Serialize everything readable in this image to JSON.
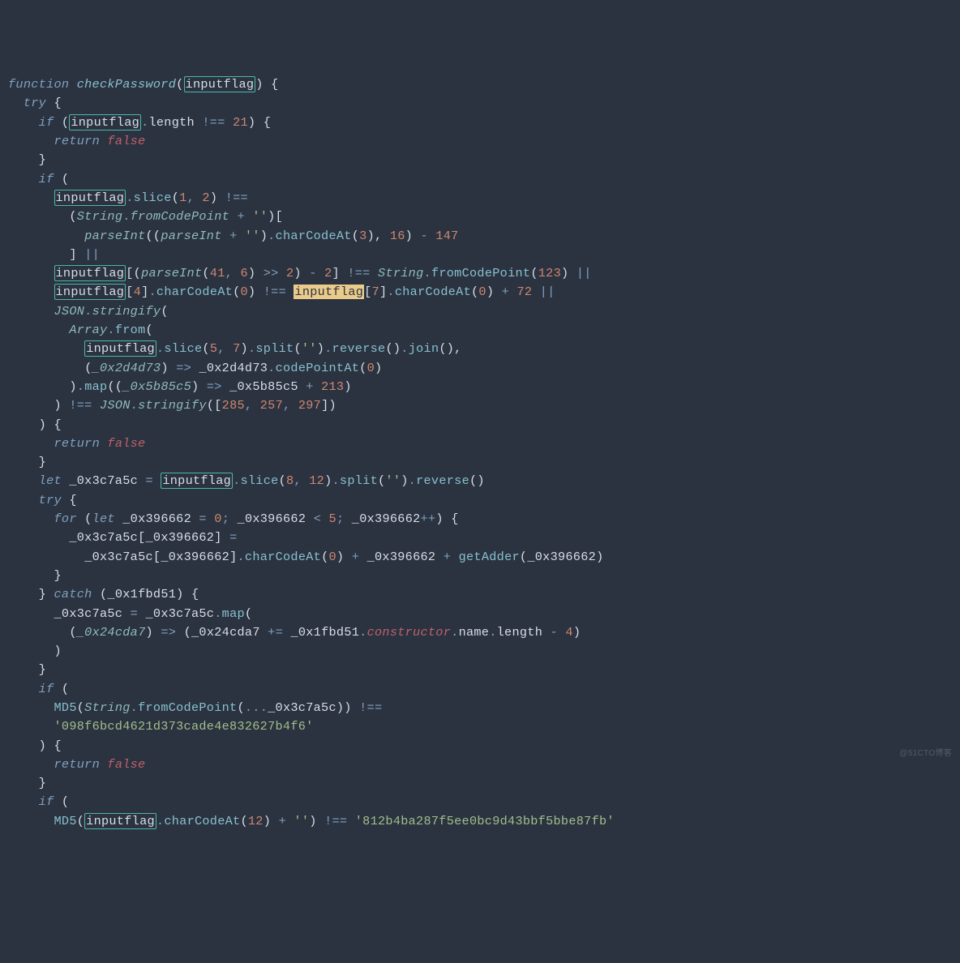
{
  "t": {
    "function": "function",
    "checkPassword": "checkPassword",
    "inputflag": "inputflag",
    "try": "try",
    "if": "if",
    "length": "length",
    "neq": "!==",
    "return": "return",
    "false": "false",
    "slice": "slice",
    "String": "String",
    "fromCodePoint": "fromCodePoint",
    "parseInt": "parseInt",
    "charCodeAt": "charCodeAt",
    "JSON": "JSON",
    "stringify": "stringify",
    "Array": "Array",
    "from": "from",
    "split": "split",
    "reverse": "reverse",
    "join": "join",
    "codePointAt": "codePointAt",
    "map": "map",
    "let": "let",
    "for": "for",
    "catch": "catch",
    "getAdder": "getAdder",
    "constructor": "constructor",
    "name": "name",
    "MD5": "MD5",
    "n21": "21",
    "n1": "1",
    "n2": "2",
    "n3": "3",
    "n4": "4",
    "n5": "5",
    "n6": "6",
    "n7": "7",
    "n8": "8",
    "n12": "12",
    "n16": "16",
    "n41": "41",
    "n72": "72",
    "n123": "123",
    "n147": "147",
    "n213": "213",
    "n257": "257",
    "n285": "285",
    "n297": "297",
    "n0": "0",
    "v_0x3c7a5c": "_0x3c7a5c",
    "v_0x396662": "_0x396662",
    "v_0x1fbd51": "_0x1fbd51",
    "v_0x24cda7": "_0x24cda7",
    "v_0x2d4d73": "_0x2d4d73",
    "v_0x5b85c5": "_0x5b85c5",
    "sq": "''",
    "md5_1": "'098f6bcd4621d373cade4e832627b4f6'",
    "md5_2": "'812b4ba287f5ee0bc9d43bbf5bbe87fb'",
    "watermark": "@51CTO博客"
  }
}
